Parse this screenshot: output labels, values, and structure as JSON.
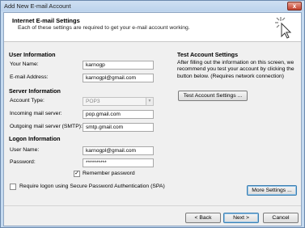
{
  "window": {
    "title": "Add New E-mail Account",
    "close_glyph": "x"
  },
  "header": {
    "title": "Internet E-mail Settings",
    "subtitle": "Each of these settings are required to get your e-mail account working."
  },
  "user_info": {
    "heading": "User Information",
    "your_name_label": "Your Name:",
    "your_name_value": "karnogp",
    "email_label": "E-mail Address:",
    "email_value": "karnogpl@gmail.com"
  },
  "server_info": {
    "heading": "Server Information",
    "account_type_label": "Account Type:",
    "account_type_value": "POP3",
    "incoming_label": "Incoming mail server:",
    "incoming_value": "pop.gmail.com",
    "outgoing_label": "Outgoing mail server (SMTP):",
    "outgoing_value": "smtp.gmail.com"
  },
  "logon_info": {
    "heading": "Logon Information",
    "user_name_label": "User Name:",
    "user_name_value": "karnogpl@gmail.com",
    "password_label": "Password:",
    "password_value": "**********",
    "remember_label": "Remember password",
    "remember_checked": true,
    "spa_label": "Require logon using Secure Password Authentication (SPA)",
    "spa_checked": false
  },
  "test_account": {
    "heading": "Test Account Settings",
    "description": "After filling out the information on this screen, we recommend you test your account by clicking the button below. (Requires network connection)",
    "test_button": "Test Account Settings ..."
  },
  "buttons": {
    "more_settings": "More Settings ...",
    "back": "< Back",
    "next": "Next >",
    "cancel": "Cancel"
  },
  "icons": {
    "close": "close-icon",
    "cursor": "cursor-click-icon",
    "dropdown": "chevron-down-icon",
    "check": "checkmark-icon"
  }
}
